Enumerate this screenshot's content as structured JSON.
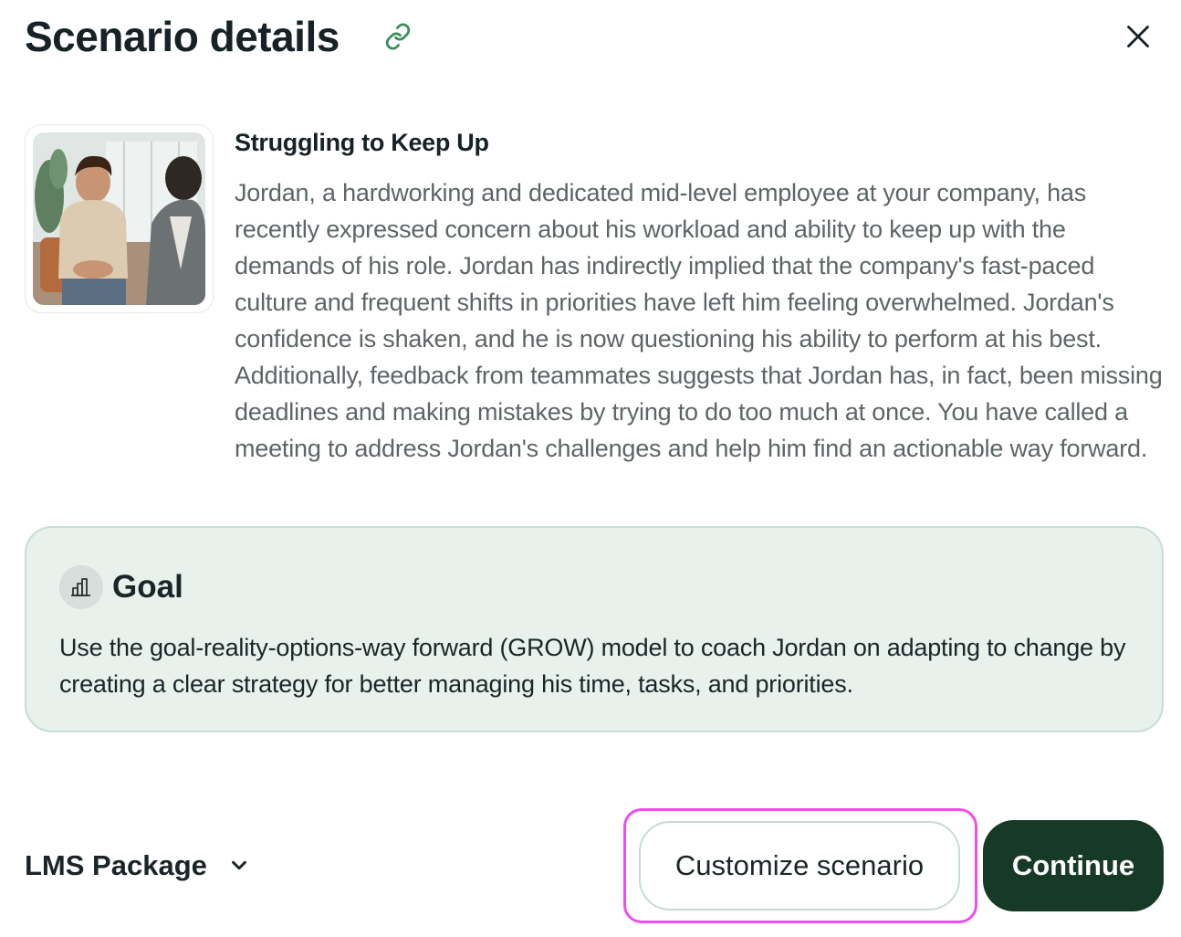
{
  "header": {
    "title": "Scenario details",
    "link_icon": "link-icon",
    "close_icon": "close-icon"
  },
  "scenario": {
    "image_alt": "illustration of Jordan in a meeting",
    "title": "Struggling to Keep Up",
    "description": "Jordan, a hardworking and dedicated mid-level employee at your company, has recently expressed concern about his workload and ability to keep up with the demands of his role. Jordan has indirectly implied that the company's fast-paced culture and frequent shifts in priorities have left him feeling overwhelmed. Jordan's confidence is shaken, and he is now questioning his ability to perform at his best. Additionally, feedback from teammates suggests that Jordan has, in fact, been missing deadlines and making mistakes by trying to do too much at once. You have called a meeting to address Jordan's challenges and help him find an actionable way forward."
  },
  "goal": {
    "icon": "bar-chart-icon",
    "title": "Goal",
    "text": "Use the goal-reality-options-way forward (GROW) model to coach Jordan on adapting to change by creating a clear strategy for better managing his time, tasks, and priorities."
  },
  "footer": {
    "lms_label": "LMS Package",
    "lms_icon": "chevron-down-icon",
    "customize_label": "Customize scenario",
    "continue_label": "Continue"
  },
  "colors": {
    "accent_green": "#173a26",
    "link_green": "#3e8e5a",
    "goal_bg": "#e8f1ec",
    "highlight": "#ec4ff0"
  }
}
